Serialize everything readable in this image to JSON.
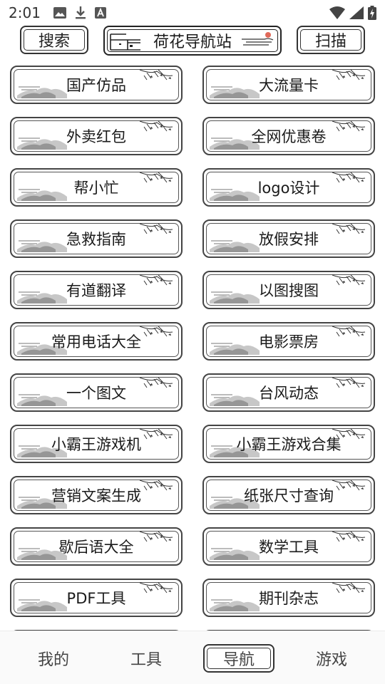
{
  "status": {
    "time": "2:01",
    "left_icons": [
      "image-icon",
      "download-icon",
      "a-box-icon"
    ],
    "right_icons": [
      "wifi-icon",
      "signal-icon",
      "battery-charging-icon"
    ]
  },
  "header": {
    "search_label": "搜索",
    "title": "荷花导航站",
    "scan_label": "扫描"
  },
  "items": [
    "国产仿品",
    "大流量卡",
    "外卖红包",
    "全网优惠卷",
    "帮小忙",
    "logo设计",
    "急救指南",
    "放假安排",
    "有道翻译",
    "以图搜图",
    "常用电话大全",
    "电影票房",
    "一个图文",
    "台风动态",
    "小霸王游戏机",
    "小霸王游戏合集",
    "营销文案生成",
    "纸张尺寸查询",
    "歇后语大全",
    "数学工具",
    "PDF工具",
    "期刊杂志"
  ],
  "nav": {
    "items": [
      "我的",
      "工具",
      "导航",
      "游戏"
    ],
    "active": "导航"
  }
}
